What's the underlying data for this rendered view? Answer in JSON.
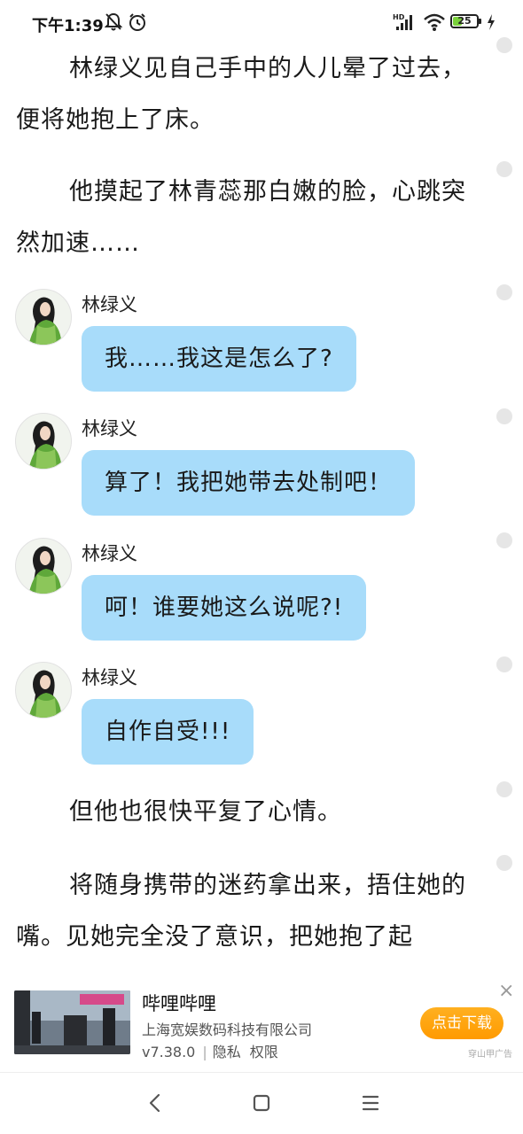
{
  "status_bar": {
    "time": "下午1:39",
    "network": "HD",
    "battery": "25"
  },
  "story": {
    "para1": "林绿义见自己手中的人儿晕了过去，便将她抱上了床。",
    "para2": "他摸起了林青蕊那白嫩的脸，心跳突然加速……",
    "para3": "但他也很快平复了心情。",
    "para4": "将随身携带的迷药拿出来，捂住她的嘴。见她完全没了意识，把她抱了起"
  },
  "messages": [
    {
      "speaker": "林绿义",
      "text": "我……我这是怎么了?"
    },
    {
      "speaker": "林绿义",
      "text": "算了！我把她带去处制吧！"
    },
    {
      "speaker": "林绿义",
      "text": "呵！谁要她这么说呢?!"
    },
    {
      "speaker": "林绿义",
      "text": "自作自受!!!"
    }
  ],
  "ad": {
    "title": "哔哩哔哩",
    "company": "上海宽娱数码科技有限公司",
    "version": "v7.38.0",
    "privacy": "隐私",
    "permissions": "权限",
    "button": "点击下载",
    "close": "×",
    "source": "穿山甲广告"
  },
  "colors": {
    "bubble": "#a8dcfa",
    "ad_button": "#ff9a00",
    "battery_fill": "#7ad13b"
  },
  "icons": [
    "mute-icon",
    "alarm-icon",
    "signal-icon",
    "wifi-icon",
    "battery-icon",
    "charging-icon",
    "back-icon",
    "home-icon",
    "menu-icon"
  ]
}
